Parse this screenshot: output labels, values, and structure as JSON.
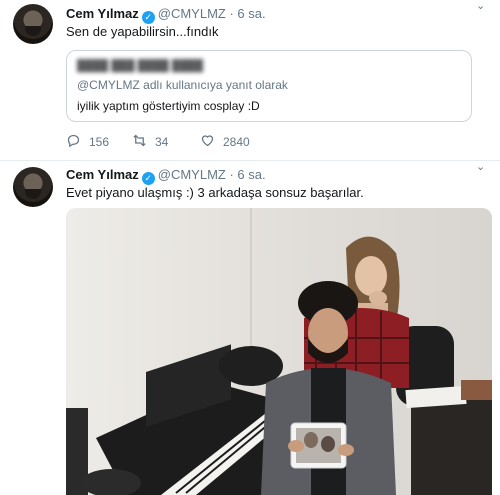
{
  "tweets": [
    {
      "name": "Cem Yılmaz",
      "handle": "@CMYLMZ",
      "time": "· 6 sa.",
      "text": "Sen de yapabilirsin...fındık",
      "quote": {
        "reply_to": "@CMYLMZ adlı kullanıcıya yanıt olarak",
        "text": "iyilik yaptım göstertiyim cosplay :D"
      },
      "actions": {
        "replies": "156",
        "retweets": "34",
        "likes": "2840"
      }
    },
    {
      "name": "Cem Yılmaz",
      "handle": "@CMYLMZ",
      "time": "· 6 sa.",
      "text": "Evet piyano ulaşmış :) 3 arkadaşa sonsuz başarılar."
    }
  ],
  "icons": {
    "verified": "verified-badge-icon",
    "reply": "reply-icon",
    "retweet": "retweet-icon",
    "like": "heart-icon",
    "more": "more-options-icon"
  },
  "colors": {
    "accent": "#1da1f2",
    "muted_text": "#657786",
    "divider": "#e6ecf0"
  }
}
